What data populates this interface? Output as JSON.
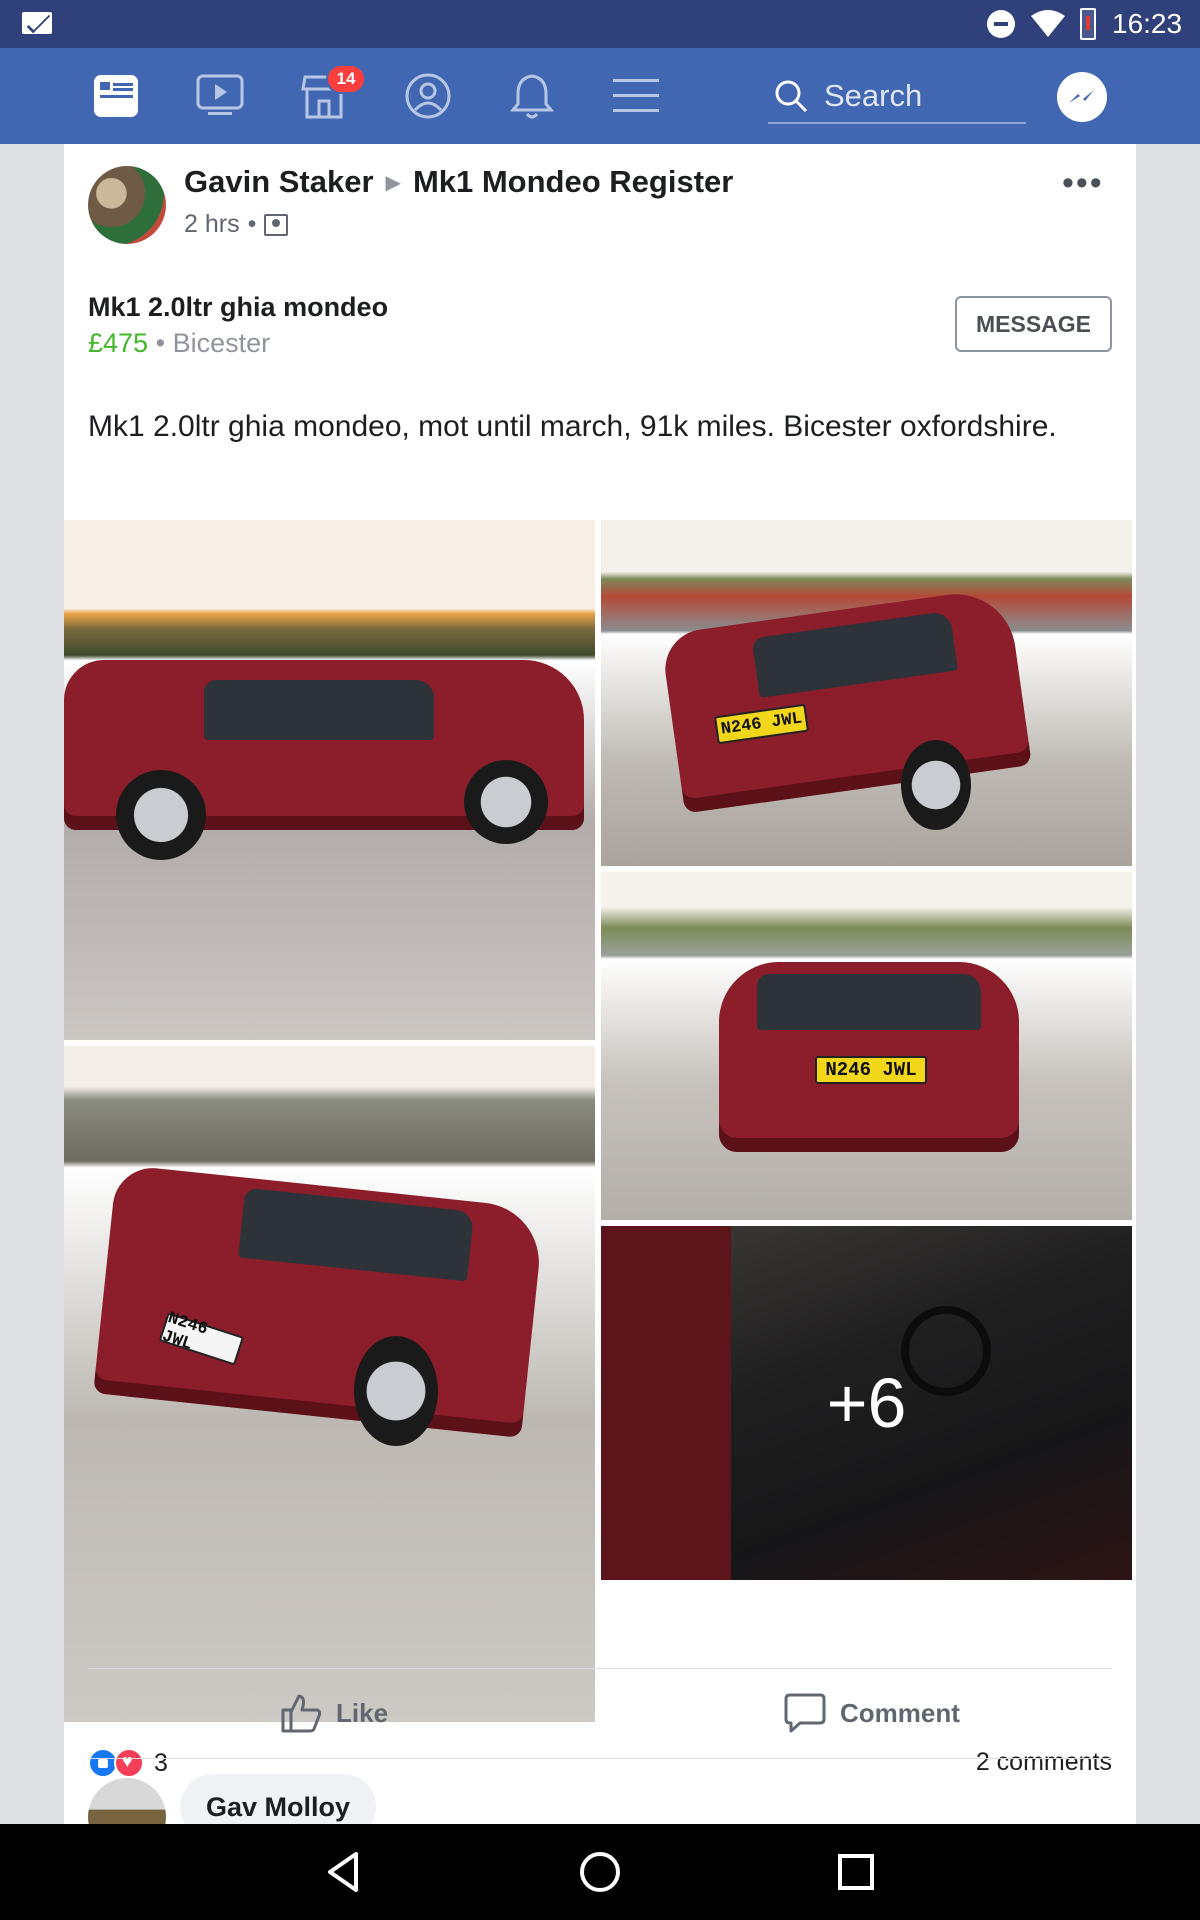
{
  "status_bar": {
    "time": "16:23",
    "icons": [
      "mail-icon",
      "do-not-disturb-icon",
      "wifi-icon",
      "battery-low-icon"
    ]
  },
  "top_nav": {
    "icons": [
      "news-feed-icon",
      "watch-icon",
      "marketplace-icon",
      "profile-icon",
      "notifications-icon",
      "menu-icon",
      "messenger-icon"
    ],
    "marketplace_badge": "14",
    "search_placeholder": "Search"
  },
  "post": {
    "author": "Gavin Staker",
    "group": "Mk1 Mondeo Register",
    "time": "2 hrs",
    "separator": "•",
    "listing": {
      "title": "Mk1 2.0ltr ghia mondeo",
      "price": "£475",
      "location_separator": "•",
      "location": "Bicester",
      "message_button": "MESSAGE"
    },
    "text": "Mk1 2.0ltr ghia mondeo,  mot until march,  91k miles.  Bicester oxfordshire.",
    "photos": {
      "plate_rear": "N246 JWL",
      "plate_front": "N246 JWL",
      "more_count": "+6"
    },
    "reactions_count": "3",
    "comments_count": "2 comments",
    "actions": {
      "like": "Like",
      "comment": "Comment"
    },
    "first_commenter": "Gav Molloy"
  },
  "colors": {
    "fb_blue": "#4267b2",
    "status_bar": "#30407a",
    "price_green": "#42b72a"
  }
}
